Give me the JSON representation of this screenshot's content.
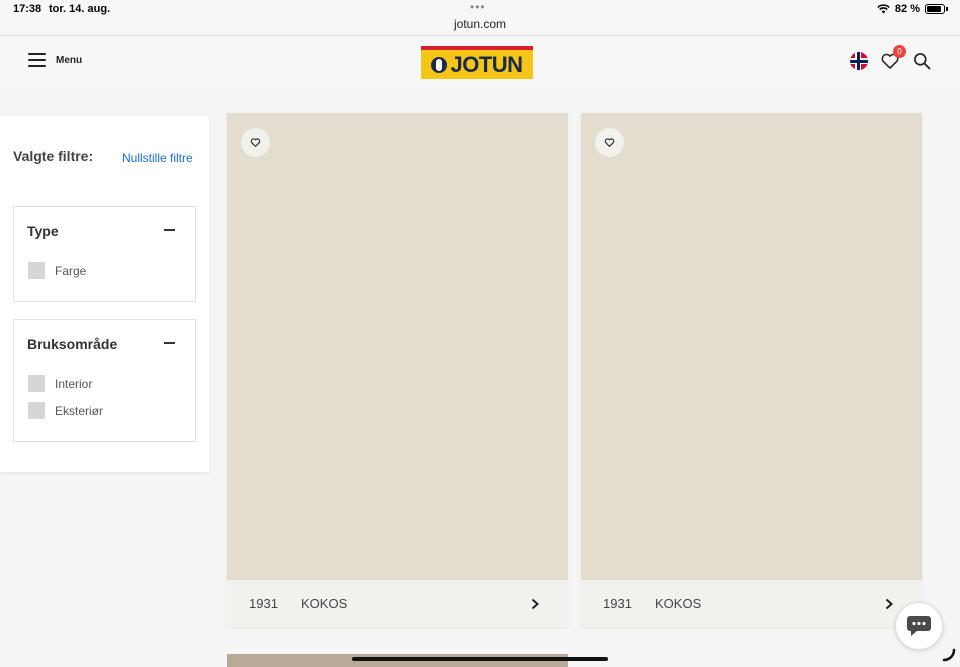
{
  "status_bar": {
    "time": "17:38",
    "date": "tor. 14. aug.",
    "url": "jotun.com",
    "battery": "82 %"
  },
  "header": {
    "menu_label": "Menu",
    "logo_text": "JOTUN",
    "wishlist_count": "0"
  },
  "filters": {
    "selected_title": "Valgte filtre:",
    "reset_label": "Nullstille filtre",
    "groups": [
      {
        "title": "Type",
        "options": [
          "Farge"
        ]
      },
      {
        "title": "Bruksområde",
        "options": [
          "Interior",
          "Eksteriør"
        ]
      }
    ]
  },
  "products": [
    {
      "code": "1931",
      "name": "KOKOS",
      "color": "#e2ddcf"
    },
    {
      "code": "1931",
      "name": "KOKOS",
      "color": "#e2ddcf"
    }
  ],
  "colors": {
    "accent": "#1a6dc9",
    "badge": "#e8453c",
    "logo_yellow": "#f5c518",
    "logo_red": "#d5202e",
    "logo_navy": "#1b2a4a"
  }
}
